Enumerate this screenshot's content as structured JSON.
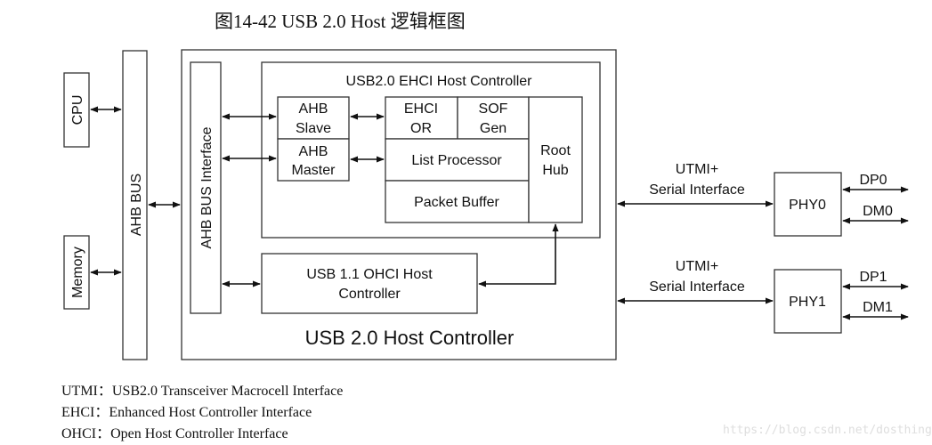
{
  "figure": {
    "title": "图14-42  USB 2.0 Host 逻辑框图"
  },
  "blocks": {
    "cpu": "CPU",
    "memory": "Memory",
    "ahb_bus": "AHB BUS",
    "ahb_bus_interface": "AHB BUS Interface",
    "usb2_host_controller": "USB 2.0 Host Controller",
    "ehci_host_controller": "USB2.0 EHCI Host Controller",
    "ahb_slave": [
      "AHB",
      "Slave"
    ],
    "ahb_master": [
      "AHB",
      "Master"
    ],
    "ehci_or": [
      "EHCI",
      "OR"
    ],
    "sof_gen": [
      "SOF",
      "Gen"
    ],
    "list_processor": "List Processor",
    "packet_buffer": "Packet Buffer",
    "root_hub": [
      "Root",
      "Hub"
    ],
    "ohci_host_controller": [
      "USB 1.1 OHCI Host",
      "Controller"
    ],
    "phy0": "PHY0",
    "phy1": "PHY1"
  },
  "connections": {
    "utmi0": [
      "UTMI+",
      "Serial Interface"
    ],
    "utmi1": [
      "UTMI+",
      "Serial Interface"
    ],
    "dp0": "DP0",
    "dm0": "DM0",
    "dp1": "DP1",
    "dm1": "DM1"
  },
  "legend": [
    "UTMI：USB2.0 Transceiver Macrocell Interface",
    "EHCI：Enhanced Host Controller Interface",
    "OHCI：Open Host Controller Interface"
  ],
  "watermark": "https://blog.csdn.net/dosthing"
}
